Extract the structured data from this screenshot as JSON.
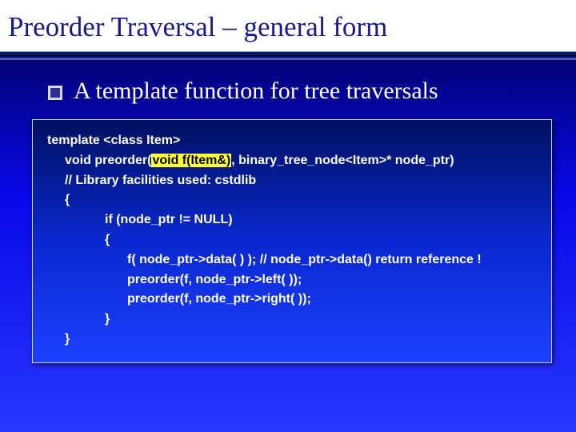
{
  "title": "Preorder Traversal – general form",
  "bullet": "A template function for tree traversals",
  "code": {
    "l0": "template <class Item>",
    "l1a": "void preorder(",
    "l1b": "void f(Item&)",
    "l1c": ", binary_tree_node<Item>*  node_ptr)",
    "l2": "// Library facilities used: cstdlib",
    "l3": "{",
    "l4": "if (node_ptr != NULL)",
    "l5": "{",
    "l6": "f( node_ptr->data( ) ); // node_ptr->data() return reference !",
    "l7": "preorder(f, node_ptr->left( ));",
    "l8": "preorder(f, node_ptr->right( ));",
    "l9": "}",
    "l10": "}"
  }
}
